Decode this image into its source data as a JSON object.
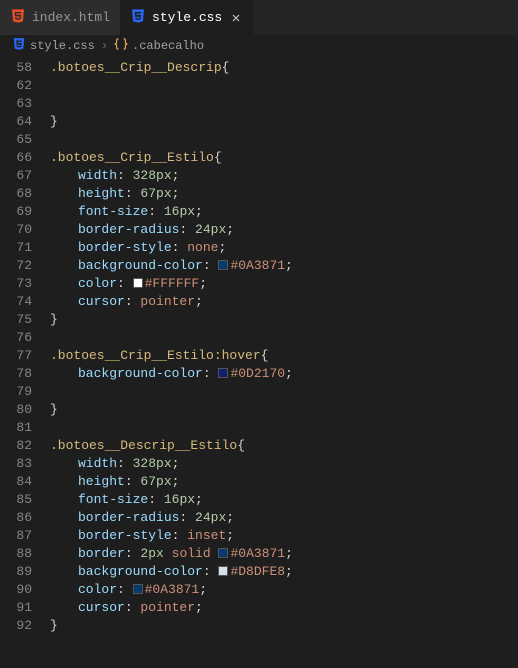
{
  "tabs": [
    {
      "label": "index.html",
      "icon": "html5-icon",
      "active": false
    },
    {
      "label": "style.css",
      "icon": "css3-icon",
      "active": true
    }
  ],
  "breadcrumbs": {
    "file": "style.css",
    "symbol": ".cabecalho"
  },
  "startLineNumber": 58,
  "code": [
    {
      "lineNumber": 58,
      "type": "selector-open",
      "selector": ".botoes__Crip__Descrip",
      "brace": "{"
    },
    {
      "lineNumber": 62,
      "type": "blank"
    },
    {
      "lineNumber": 63,
      "type": "blank"
    },
    {
      "lineNumber": 64,
      "type": "close",
      "brace": "}"
    },
    {
      "lineNumber": 65,
      "type": "blank"
    },
    {
      "lineNumber": 66,
      "type": "selector-open",
      "selector": ".botoes__Crip__Estilo",
      "brace": "{"
    },
    {
      "lineNumber": 67,
      "type": "decl",
      "prop": "width",
      "valuePrefix": "",
      "num": "328",
      "unit": "px",
      "valueSuffix": ""
    },
    {
      "lineNumber": 68,
      "type": "decl",
      "prop": "height",
      "valuePrefix": "",
      "num": "67",
      "unit": "px",
      "valueSuffix": ""
    },
    {
      "lineNumber": 69,
      "type": "decl",
      "prop": "font-size",
      "valuePrefix": "",
      "num": "16",
      "unit": "px",
      "valueSuffix": ""
    },
    {
      "lineNumber": 70,
      "type": "decl",
      "prop": "border-radius",
      "valuePrefix": "",
      "num": "24",
      "unit": "px",
      "valueSuffix": ""
    },
    {
      "lineNumber": 71,
      "type": "decl-keyword",
      "prop": "border-style",
      "value": "none"
    },
    {
      "lineNumber": 72,
      "type": "decl-color",
      "prop": "background-color",
      "color": "#0A3871"
    },
    {
      "lineNumber": 73,
      "type": "decl-color",
      "prop": "color",
      "color": "#FFFFFF"
    },
    {
      "lineNumber": 74,
      "type": "decl-keyword",
      "prop": "cursor",
      "value": "pointer"
    },
    {
      "lineNumber": 75,
      "type": "close",
      "brace": "}"
    },
    {
      "lineNumber": 76,
      "type": "blank"
    },
    {
      "lineNumber": 77,
      "type": "selector-open",
      "selector": ".botoes__Crip__Estilo:hover",
      "brace": "{"
    },
    {
      "lineNumber": 78,
      "type": "decl-color",
      "prop": "background-color",
      "color": "#0D2170"
    },
    {
      "lineNumber": 79,
      "type": "blank-indent"
    },
    {
      "lineNumber": 80,
      "type": "close",
      "brace": "}"
    },
    {
      "lineNumber": 81,
      "type": "blank"
    },
    {
      "lineNumber": 82,
      "type": "selector-open",
      "selector": ".botoes__Descrip__Estilo",
      "brace": "{"
    },
    {
      "lineNumber": 83,
      "type": "decl",
      "prop": "width",
      "valuePrefix": "",
      "num": "328",
      "unit": "px",
      "valueSuffix": ""
    },
    {
      "lineNumber": 84,
      "type": "decl",
      "prop": "height",
      "valuePrefix": "",
      "num": "67",
      "unit": "px",
      "valueSuffix": ""
    },
    {
      "lineNumber": 85,
      "type": "decl",
      "prop": "font-size",
      "valuePrefix": "",
      "num": "16",
      "unit": "px",
      "valueSuffix": ""
    },
    {
      "lineNumber": 86,
      "type": "decl",
      "prop": "border-radius",
      "valuePrefix": "",
      "num": "24",
      "unit": "px",
      "valueSuffix": ""
    },
    {
      "lineNumber": 87,
      "type": "decl-keyword",
      "prop": "border-style",
      "value": "inset"
    },
    {
      "lineNumber": 88,
      "type": "decl-border",
      "prop": "border",
      "num": "2",
      "unit": "px",
      "style": "solid",
      "color": "#0A3871"
    },
    {
      "lineNumber": 89,
      "type": "decl-color",
      "prop": "background-color",
      "color": "#D8DFE8"
    },
    {
      "lineNumber": 90,
      "type": "decl-color",
      "prop": "color",
      "color": "#0A3871"
    },
    {
      "lineNumber": 91,
      "type": "decl-keyword",
      "prop": "cursor",
      "value": "pointer"
    },
    {
      "lineNumber": 92,
      "type": "close",
      "brace": "}"
    }
  ]
}
